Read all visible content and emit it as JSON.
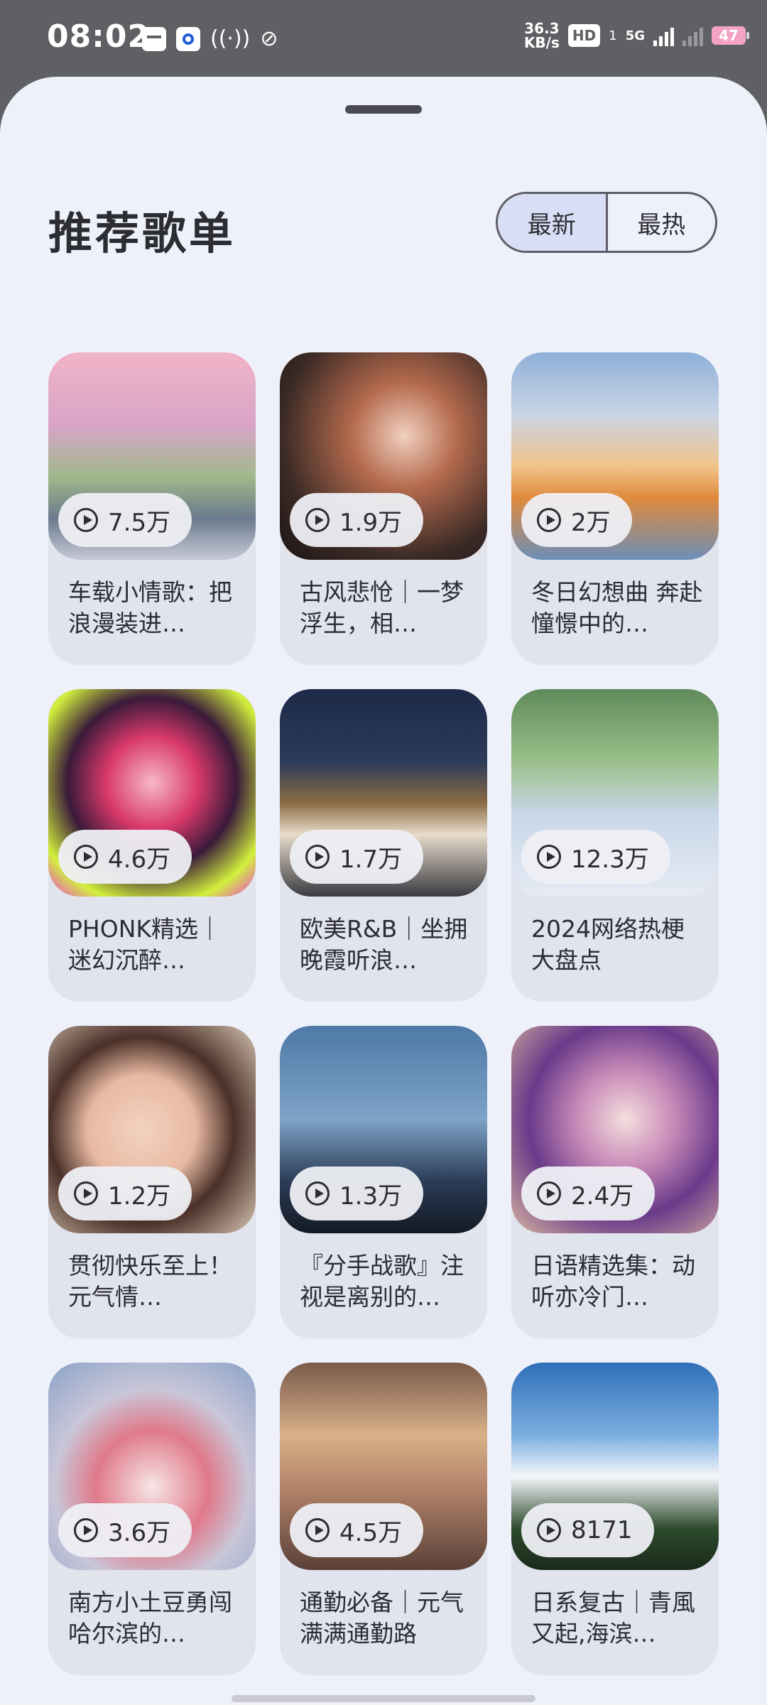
{
  "status_bar": {
    "time": "08:02",
    "net_speed_value": "36.3",
    "net_speed_unit": "KB/s",
    "hd_label": "HD",
    "sim_label": "1",
    "network_label": "5G",
    "battery": "47"
  },
  "sheet": {
    "title": "推荐歌单",
    "sort_options": [
      "最新",
      "最热"
    ],
    "active_sort": "最新"
  },
  "playlists": [
    {
      "plays": "7.5万",
      "title": "车载小情歌：把浪漫装进…",
      "cover": "convertible-car-sunset"
    },
    {
      "plays": "1.9万",
      "title": "古风悲怆｜一梦浮生，相…",
      "cover": "ancient-couple-snow"
    },
    {
      "plays": "2万",
      "title": "冬日幻想曲 奔赴憧憬中的…",
      "cover": "winter-city-lights"
    },
    {
      "plays": "4.6万",
      "title": "PHONK精选｜迷幻沉醉…",
      "cover": "anime-neon-girl"
    },
    {
      "plays": "1.7万",
      "title": "欧美R&B｜坐拥晚霞听浪…",
      "cover": "vintage-car-night"
    },
    {
      "plays": "12.3万",
      "title": "2024网络热梗大盘点",
      "cover": "anime-girl-braids"
    },
    {
      "plays": "1.2万",
      "title": "贯彻快乐至上！元气情…",
      "cover": "smiling-girl-glasses"
    },
    {
      "plays": "1.3万",
      "title": "『分手战歌』注视是离别的…",
      "cover": "seagulls-sky"
    },
    {
      "plays": "2.4万",
      "title": "日语精选集：动听亦冷门…",
      "cover": "anime-purple-hair"
    },
    {
      "plays": "3.6万",
      "title": "南方小土豆勇闯哈尔滨的…",
      "cover": "snow-kids-cartoon"
    },
    {
      "plays": "4.5万",
      "title": "通勤必备｜元气满满通勤路",
      "cover": "train-interior"
    },
    {
      "plays": "8171",
      "title": "日系复古｜青風又起,海滨…",
      "cover": "palm-trees-clouds"
    }
  ],
  "colors": {
    "sheet_bg": "#eef0fa",
    "card_bg": "#e1e3ed",
    "active_sort_bg": "#d8def5",
    "text": "#2c2d33"
  }
}
